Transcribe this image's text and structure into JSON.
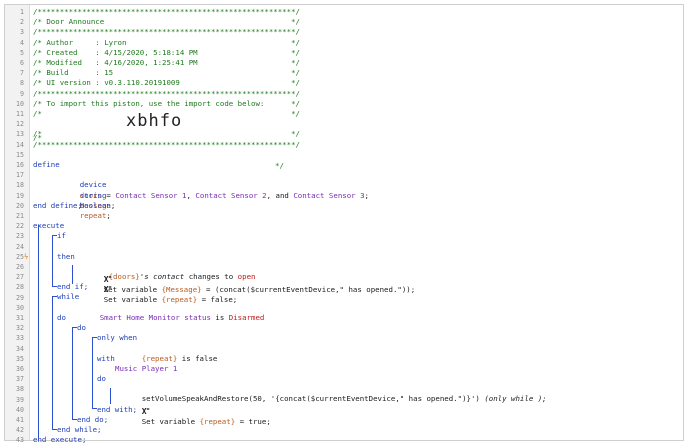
{
  "editor": {
    "lines": [
      {
        "n": "1",
        "t": "/**********************************************************/"
      },
      {
        "n": "2",
        "t": "/* Door Announce                                          */"
      },
      {
        "n": "3",
        "t": "/**********************************************************/"
      },
      {
        "n": "4",
        "t": "/* Author     : Lyron                                     */"
      },
      {
        "n": "5",
        "t": "/* Created    : 4/15/2020, 5:18:14 PM                     */"
      },
      {
        "n": "6",
        "t": "/* Modified   : 4/16/2020, 1:25:41 PM                     */"
      },
      {
        "n": "7",
        "t": "/* Build      : 15                                        */"
      },
      {
        "n": "8",
        "t": "/* UI version : v0.3.110.20191009                         */"
      },
      {
        "n": "9",
        "t": "/**********************************************************/"
      },
      {
        "n": "10",
        "t": "/* To import this piston, use the import code below:      */"
      },
      {
        "n": "11",
        "t": "/*                                                        */"
      },
      {
        "n": "12",
        "t": "/*                   xbhfo                                */"
      },
      {
        "n": "13",
        "t": "/*                                                        */"
      },
      {
        "n": "14",
        "t": "/**********************************************************/"
      },
      {
        "n": "15",
        "t": ""
      },
      {
        "n": "16",
        "t": "define"
      },
      {
        "n": "17",
        "t": "device doors = Contact Sensor 1, Contact Sensor 2, and Contact Sensor 3;"
      },
      {
        "n": "18",
        "t": "string Message;"
      },
      {
        "n": "19",
        "t": "boolean repeat;"
      },
      {
        "n": "20",
        "t": "end define;"
      },
      {
        "n": "21",
        "t": ""
      },
      {
        "n": "22",
        "t": "execute"
      },
      {
        "n": "23",
        "t": "if"
      },
      {
        "n": "24",
        "t": "{doors}'s contact changes to open"
      },
      {
        "n": "25",
        "t": "then"
      },
      {
        "n": "26",
        "t": "Set variable {Message} = (concat($currentEventDevice,\" has opened.\"));"
      },
      {
        "n": "27",
        "t": "Set variable {repeat} = false;"
      },
      {
        "n": "28",
        "t": "end if;"
      },
      {
        "n": "29",
        "t": "while"
      },
      {
        "n": "30",
        "t": "Smart Home Monitor status is Disarmed"
      },
      {
        "n": "31",
        "t": "do"
      },
      {
        "n": "32",
        "t": "do"
      },
      {
        "n": "33",
        "t": "only when"
      },
      {
        "n": "34",
        "t": "{repeat} is false"
      },
      {
        "n": "35",
        "t": "with"
      },
      {
        "n": "36",
        "t": "Music Player 1"
      },
      {
        "n": "37",
        "t": "do"
      },
      {
        "n": "38",
        "t": "setVolumeSpeakAndRestore(50, '{concat($currentEventDevice,\" has opened.\")}') (only while );"
      },
      {
        "n": "39",
        "t": "Set variable {repeat} = true;"
      },
      {
        "n": "40",
        "t": "end with;"
      },
      {
        "n": "41",
        "t": "end do;"
      },
      {
        "n": "42",
        "t": "end while;"
      },
      {
        "n": "43",
        "t": "end execute;"
      }
    ],
    "tokens": {
      "define": "define",
      "device_kw": "device",
      "doors": "doors",
      "eq": " = ",
      "cs1": "Contact Sensor 1",
      "comma1": ", ",
      "cs2": "Contact Sensor 2",
      "and": ", and ",
      "cs3": "Contact Sensor 3",
      "semi": ";",
      "string_kw": "string",
      "message": "Message",
      "boolean_kw": "boolean",
      "repeat": "repeat",
      "end_define": "end define;",
      "execute": "execute",
      "if": "if",
      "doors_ref": "{doors}",
      "s_contact": "'s contact",
      "changes_to": " changes to ",
      "open": "open",
      "then": "then",
      "set_variable": "Set variable ",
      "message_ref": "{Message}",
      "assign": " = ",
      "concat_expr": "(concat($currentEventDevice,\" has opened.\"));",
      "repeat_ref": "{repeat}",
      "false_val": "false;",
      "end_if": "end if;",
      "while": "while",
      "shm": "Smart Home Monitor status",
      "is": " is ",
      "disarmed": "Disarmed",
      "do": "do",
      "only_when": "only when",
      "is_false": " is false",
      "with": "with",
      "music_player": "Music Player 1",
      "speak_call": "setVolumeSpeakAndRestore(50, '{concat($currentEventDevice,\" has opened.\")}') ",
      "only_while": "(only while );",
      "true_val": "true;",
      "end_with": "end with;",
      "end_do": "end do;",
      "end_while": "end while;",
      "end_execute": "end execute;",
      "x_glyph": "X",
      "x_sup": "=",
      "trigger_glyph": "ϟ"
    },
    "header": {
      "c1": "/**********************************************************/",
      "c2": "/* Door Announce                                          */",
      "c3": "/**********************************************************/",
      "c4": "/* Author     : Lyron                                     */",
      "c5": "/* Created    : 4/15/2020, 5:18:14 PM                     */",
      "c6": "/* Modified   : 4/16/2020, 1:25:41 PM                     */",
      "c7": "/* Build      : 15                                        */",
      "c8": "/* UI version : v0.3.110.20191009                         */",
      "c9": "/**********************************************************/",
      "c10": "/* To import this piston, use the import code below:      */",
      "c11": "/*                                                        */",
      "c12a": "/*",
      "c12b": "xbhfo",
      "c12c": "*/",
      "c13": "/*                                                        */",
      "c14": "/**********************************************************/"
    },
    "line_numbers": [
      "1",
      "2",
      "3",
      "4",
      "5",
      "6",
      "7",
      "8",
      "9",
      "10",
      "11",
      "12",
      "13",
      "14",
      "15",
      "16",
      "17",
      "18",
      "19",
      "20",
      "21",
      "22",
      "23",
      "24",
      "25",
      "26",
      "27",
      "28",
      "29",
      "30",
      "31",
      "32",
      "33",
      "34",
      "35",
      "36",
      "37",
      "38",
      "39",
      "40",
      "41",
      "42",
      "43"
    ]
  }
}
